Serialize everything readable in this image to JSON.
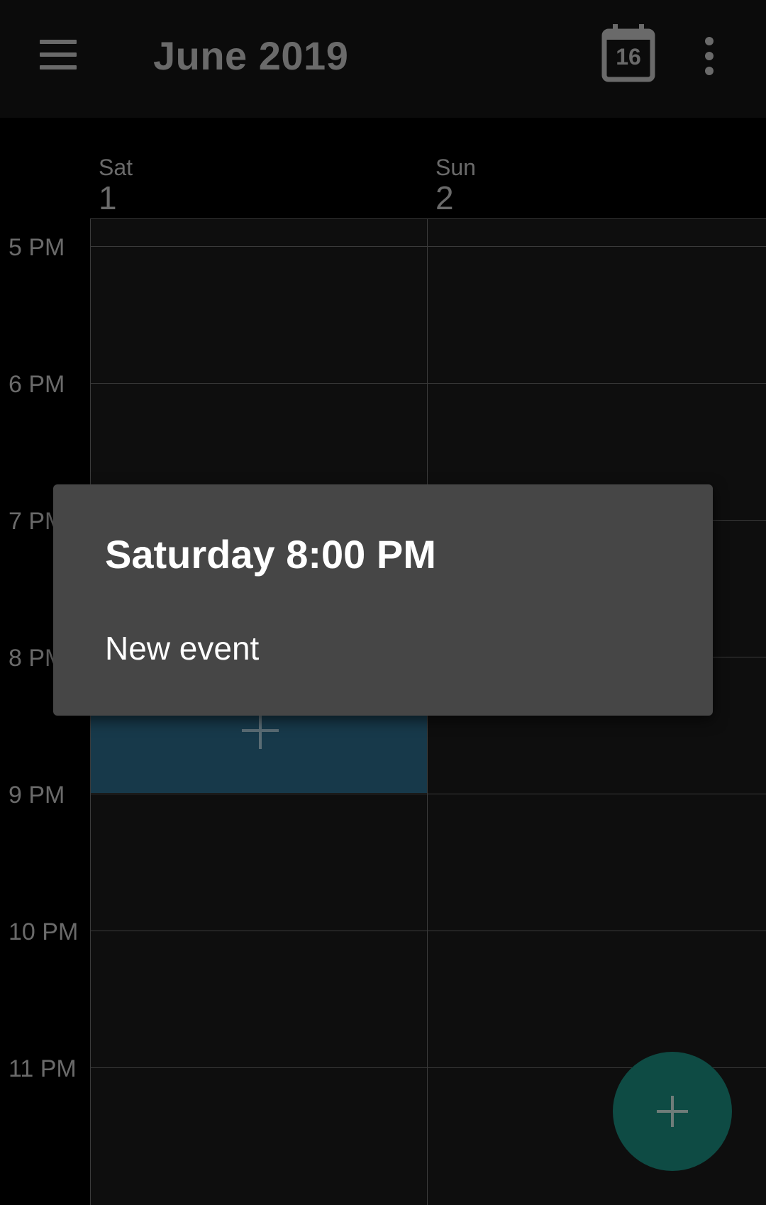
{
  "app_bar": {
    "title": "June 2019",
    "today_icon": "calendar-today-icon",
    "today_date": "16",
    "menu_icon": "hamburger-menu-icon",
    "overflow_icon": "more-vert-icon"
  },
  "days": [
    {
      "name": "Sat",
      "number": "1"
    },
    {
      "name": "Sun",
      "number": "2"
    }
  ],
  "time_labels": [
    "5 PM",
    "6 PM",
    "7 PM",
    "8 PM",
    "9 PM",
    "10 PM",
    "11 PM"
  ],
  "popup": {
    "title": "Saturday 8:00 PM",
    "option": "New event"
  },
  "fab": {
    "icon": "add-icon"
  },
  "colors": {
    "background": "#000000",
    "grid": "#0e0e0e",
    "selected_slot": "#17394a",
    "popup": "#464646",
    "fab": "#0e4b44",
    "muted_text": "#6a6a6a"
  }
}
